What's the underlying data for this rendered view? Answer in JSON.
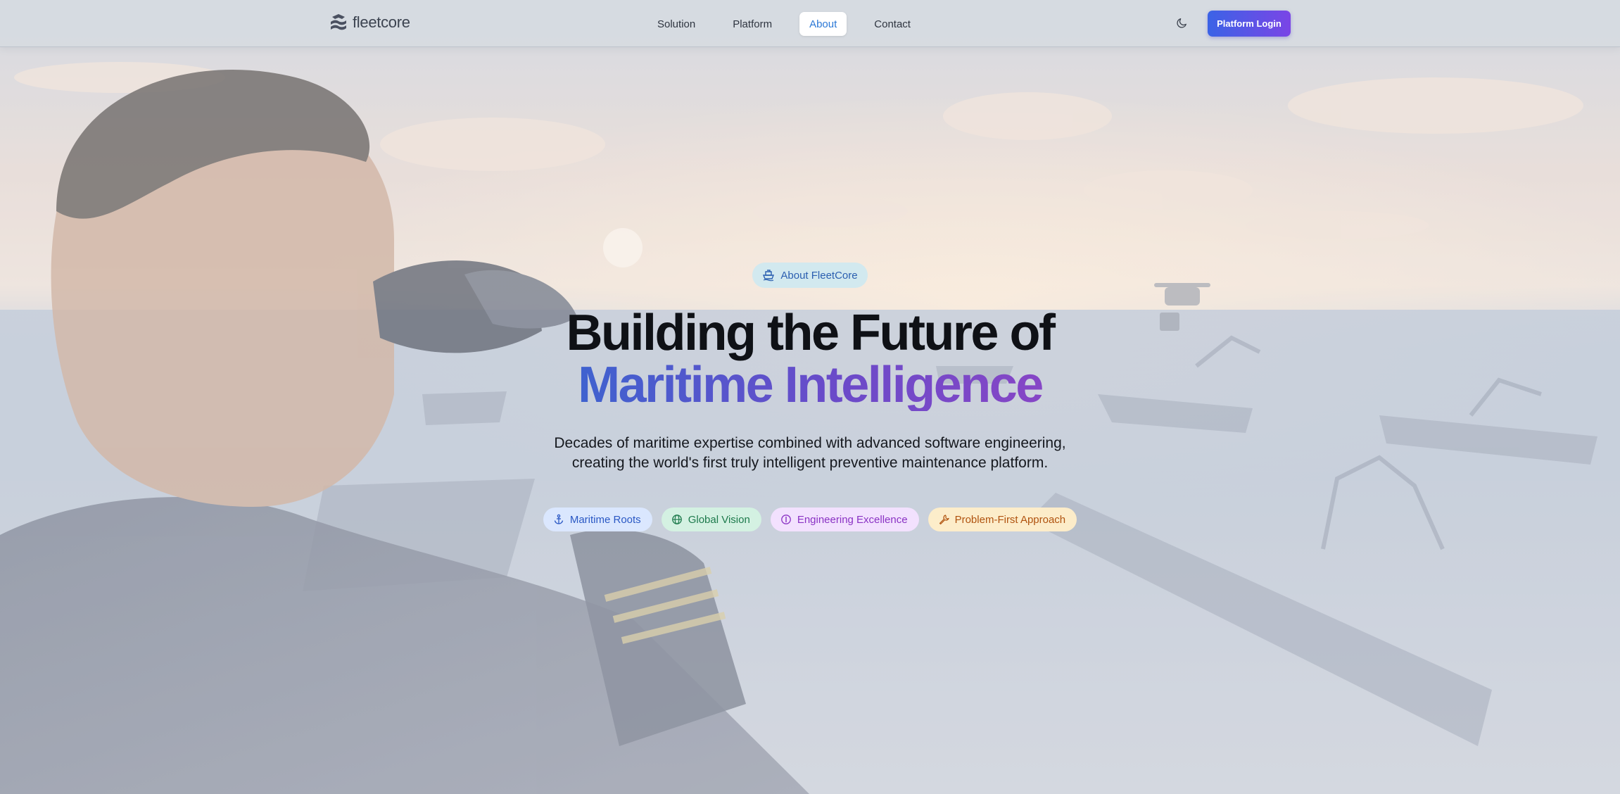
{
  "nav": {
    "logo_text": "fleetcore",
    "links": [
      {
        "label": "Solution"
      },
      {
        "label": "Platform"
      },
      {
        "label": "About"
      },
      {
        "label": "Contact"
      }
    ],
    "active_link": "About",
    "theme_toggle_icon": "moon-icon",
    "login_label": "Platform Login"
  },
  "hero": {
    "badge_label": "About FleetCore",
    "title_line1": "Building the Future of",
    "title_line2": "Maritime Intelligence",
    "subtitle_line1": "Decades of maritime expertise combined with advanced software engineering,",
    "subtitle_line2": "creating the world's first truly intelligent preventive maintenance platform.",
    "pills": [
      {
        "label": "Maritime Roots",
        "icon": "anchor-icon",
        "color": "#2a58c4"
      },
      {
        "label": "Global Vision",
        "icon": "globe-icon",
        "color": "#1d7a4c"
      },
      {
        "label": "Engineering Excellence",
        "icon": "lightbulb-icon",
        "color": "#8a32c4"
      },
      {
        "label": "Problem-First Approach",
        "icon": "wrench-icon",
        "color": "#b0530f"
      }
    ]
  },
  "colors": {
    "accent": "#2b78d6",
    "login_gradient": [
      "#3b63e6",
      "#7a45e6"
    ],
    "title_gradient": [
      "#3f62cf",
      "#8646c6"
    ]
  }
}
